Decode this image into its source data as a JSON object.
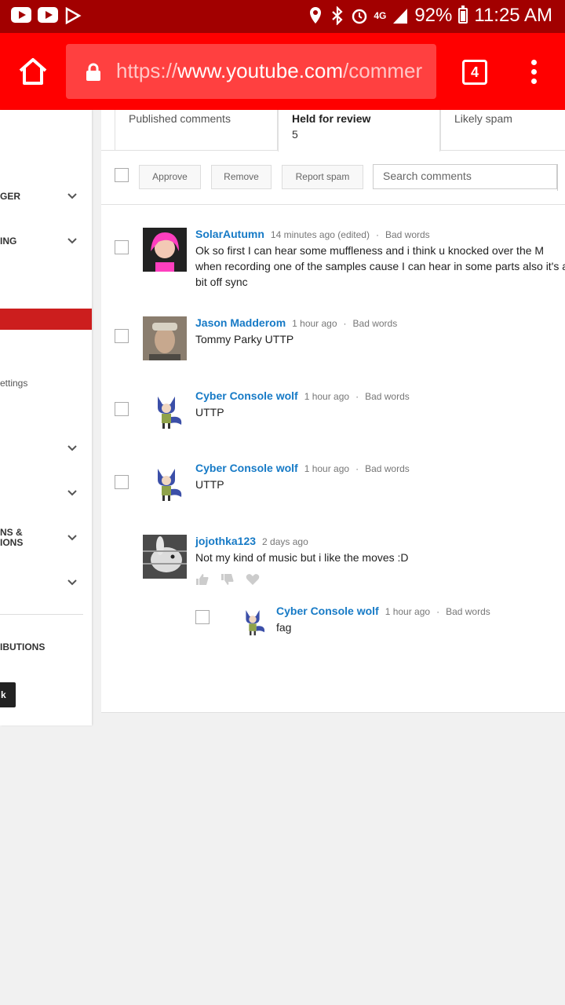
{
  "status_bar": {
    "battery": "92%",
    "time": "11:25 AM",
    "network": "4G"
  },
  "browser": {
    "url_scheme": "https://",
    "url_host": "www.youtube.com",
    "url_path": "/commer",
    "tab_count": "4"
  },
  "sidebar": {
    "items": [
      {
        "label": "GER"
      },
      {
        "label": "ING"
      },
      {
        "label": "ettings"
      },
      {
        "label": "NS &"
      },
      {
        "label": "IONS"
      },
      {
        "label": "IBUTIONS"
      },
      {
        "label": "k"
      }
    ]
  },
  "tabs": [
    {
      "label": "Published comments",
      "count": ""
    },
    {
      "label": "Held for review",
      "count": "5"
    },
    {
      "label": "Likely spam",
      "count": ""
    }
  ],
  "actions": {
    "approve": "Approve",
    "remove": "Remove",
    "report_spam": "Report spam",
    "search_placeholder": "Search comments"
  },
  "comments": [
    {
      "author": "SolarAutumn",
      "time": "14 minutes ago (edited)",
      "tag": "Bad words",
      "text": "Ok so first I can hear some muffleness and i think u knocked over the M when recording one of the samples cause I can hear in some parts also it's a bit off sync"
    },
    {
      "author": "Jason Madderom",
      "time": "1 hour ago",
      "tag": "Bad words",
      "text": "Tommy Parky UTTP"
    },
    {
      "author": "Cyber Console wolf",
      "time": "1 hour ago",
      "tag": "Bad words",
      "text": "UTTP"
    },
    {
      "author": "Cyber Console wolf",
      "time": "1 hour ago",
      "tag": "Bad words",
      "text": "UTTP"
    },
    {
      "author": "jojothka123",
      "time": "2 days ago",
      "tag": "",
      "text": "Not my kind of music but i like the moves :D"
    },
    {
      "author": "Cyber Console wolf",
      "time": "1 hour ago",
      "tag": "Bad words",
      "text": "fag"
    }
  ],
  "separator": "·",
  "colors": {
    "status_bar": "#a20000",
    "toolbar": "#ff0000",
    "link": "#167ac6",
    "sidebar_active": "#cc1e1e"
  }
}
